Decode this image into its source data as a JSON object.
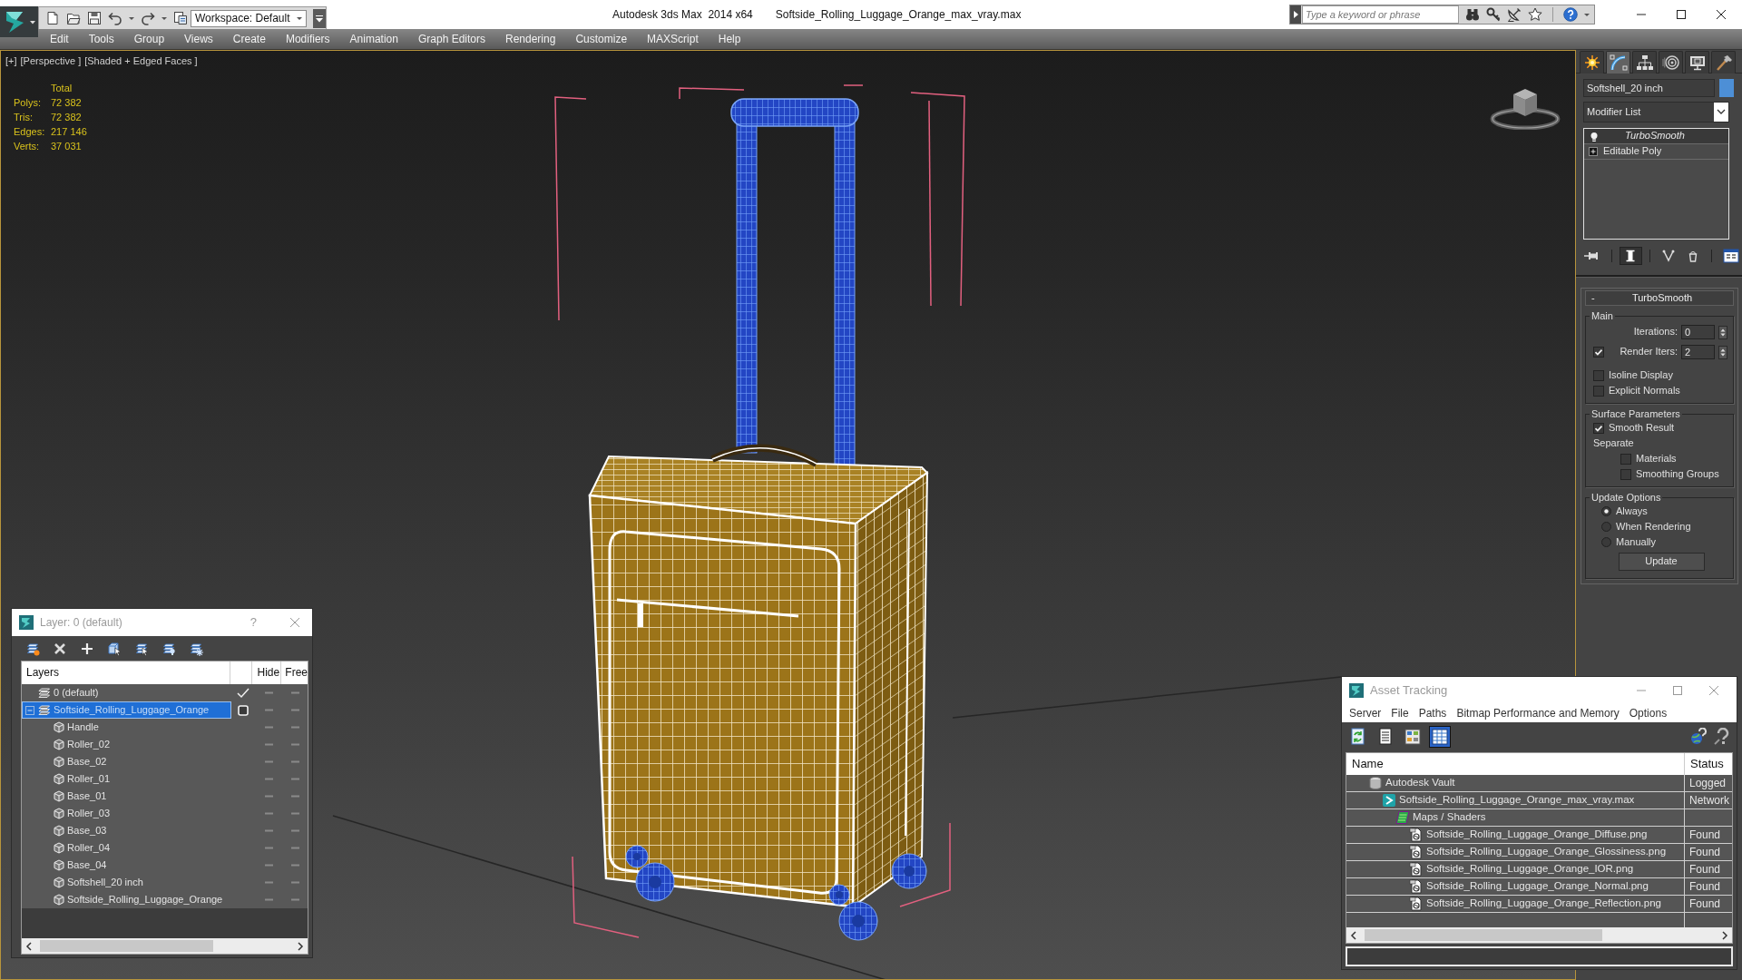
{
  "title_bar": {
    "workspace": "Workspace: Default",
    "app_title": "Autodesk 3ds Max  2014 x64",
    "file_name": "Softside_Rolling_Luggage_Orange_max_vray.max",
    "search": {
      "placeholder": "Type a keyword or phrase"
    }
  },
  "menu_bar": [
    "Edit",
    "Tools",
    "Group",
    "Views",
    "Create",
    "Modifiers",
    "Animation",
    "Graph Editors",
    "Rendering",
    "Customize",
    "MAXScript",
    "Help"
  ],
  "viewport": {
    "labels": [
      "[+]",
      "[Perspective ]",
      "[Shaded + Edged Faces ]"
    ],
    "stats": {
      "header": "Total",
      "rows": [
        {
          "label": "Polys:",
          "value": "72 382"
        },
        {
          "label": "Tris:",
          "value": "72 382"
        },
        {
          "label": "Edges:",
          "value": "217 146"
        },
        {
          "label": "Verts:",
          "value": "37 031"
        }
      ]
    }
  },
  "command_panel": {
    "tabs": [
      {
        "kind": "create",
        "selected": false
      },
      {
        "kind": "modify",
        "selected": true
      },
      {
        "kind": "hierarchy",
        "selected": false
      },
      {
        "kind": "motion",
        "selected": false
      },
      {
        "kind": "display",
        "selected": false
      },
      {
        "kind": "utilities",
        "selected": false
      }
    ],
    "object_name": "Softshell_20 inch",
    "modifier_list": "Modifier List",
    "stack": [
      {
        "kind": "modifier",
        "label": "TurboSmooth",
        "selected": true
      },
      {
        "kind": "base_object",
        "label": "Editable Poly",
        "selected": false
      }
    ],
    "stack_tools": [
      {
        "kind": "pin",
        "on": false
      },
      {
        "kind": "show_end_result",
        "on": true
      },
      {
        "kind": "make_unique",
        "on": false
      },
      {
        "kind": "remove_modifier",
        "on": false
      },
      {
        "kind": "configure",
        "on": false
      }
    ],
    "rollout": {
      "collapse_label": "-",
      "title": "TurboSmooth",
      "groups": [
        {
          "title": "Main",
          "items": [
            {
              "kind": "spinner",
              "label": "Iterations:",
              "value": "0"
            },
            {
              "kind": "check_spinner",
              "label": "Render Iters:",
              "checked": true,
              "value": "2"
            },
            {
              "kind": "checkbox",
              "label": "Isoline Display",
              "checked": false
            },
            {
              "kind": "checkbox",
              "label": "Explicit Normals",
              "checked": false
            }
          ]
        },
        {
          "title": "Surface Parameters",
          "items": [
            {
              "kind": "checkbox",
              "label": "Smooth Result",
              "checked": true
            },
            {
              "kind": "label",
              "label": "Separate",
              "children": [
                {
                  "kind": "checkbox",
                  "label": "Materials",
                  "checked": false
                },
                {
                  "kind": "checkbox",
                  "label": "Smoothing Groups",
                  "checked": false
                }
              ]
            }
          ]
        },
        {
          "title": "Update Options",
          "items": [
            {
              "kind": "radio",
              "label": "Always",
              "selected": true
            },
            {
              "kind": "radio",
              "label": "When Rendering",
              "selected": false
            },
            {
              "kind": "radio",
              "label": "Manually",
              "selected": false
            },
            {
              "kind": "button",
              "label": "Update"
            }
          ]
        }
      ]
    }
  },
  "layer_manager": {
    "title": "Layer: 0 (default)",
    "help_label": "?",
    "columns": [
      "Layers",
      "Hide",
      "Free"
    ],
    "layers": [
      {
        "kind": "layer",
        "label": "0 (default)",
        "current": true,
        "selected": false
      },
      {
        "kind": "layer",
        "label": "Softside_Rolling_Luggage_Orange",
        "current": false,
        "selected": true,
        "expanded": true,
        "children": [
          {
            "kind": "object",
            "label": "Handle",
            "selected": false
          },
          {
            "kind": "object",
            "label": "Roller_02",
            "selected": false
          },
          {
            "kind": "object",
            "label": "Base_02",
            "selected": false
          },
          {
            "kind": "object",
            "label": "Roller_01",
            "selected": false
          },
          {
            "kind": "object",
            "label": "Base_01",
            "selected": false
          },
          {
            "kind": "object",
            "label": "Roller_03",
            "selected": false
          },
          {
            "kind": "object",
            "label": "Base_03",
            "selected": false
          },
          {
            "kind": "object",
            "label": "Roller_04",
            "selected": false
          },
          {
            "kind": "object",
            "label": "Base_04",
            "selected": false
          },
          {
            "kind": "object",
            "label": "Softshell_20 inch",
            "selected": false
          },
          {
            "kind": "object",
            "label": "Softside_Rolling_Luggage_Orange",
            "selected": false
          }
        ]
      }
    ]
  },
  "asset_tracking": {
    "title": "Asset Tracking",
    "menu": [
      "Server",
      "File",
      "Paths",
      "Bitmap Performance and Memory",
      "Options"
    ],
    "views": [
      {
        "kind": "refresh",
        "selected": false
      },
      {
        "kind": "list",
        "selected": false
      },
      {
        "kind": "thumbnails",
        "selected": false
      },
      {
        "kind": "table",
        "selected": true
      }
    ],
    "columns": [
      "Name",
      "Status"
    ],
    "assets": [
      {
        "kind": "vault",
        "name": "Autodesk Vault",
        "status": "Logged",
        "children": [
          {
            "kind": "scene_file",
            "name": "Softside_Rolling_Luggage_Orange_max_vray.max",
            "status": "Network",
            "children": [
              {
                "kind": "folder",
                "name": "Maps / Shaders",
                "children": [
                  {
                    "kind": "bitmap",
                    "name": "Softside_Rolling_Luggage_Orange_Diffuse.png",
                    "status": "Found"
                  },
                  {
                    "kind": "bitmap",
                    "name": "Softside_Rolling_Luggage_Orange_Glossiness.png",
                    "status": "Found"
                  },
                  {
                    "kind": "bitmap",
                    "name": "Softside_Rolling_Luggage_Orange_IOR.png",
                    "status": "Found"
                  },
                  {
                    "kind": "bitmap",
                    "name": "Softside_Rolling_Luggage_Orange_Normal.png",
                    "status": "Found"
                  },
                  {
                    "kind": "bitmap",
                    "name": "Softside_Rolling_Luggage_Orange_Reflection.png",
                    "status": "Found"
                  }
                ]
              }
            ]
          }
        ]
      }
    ]
  }
}
